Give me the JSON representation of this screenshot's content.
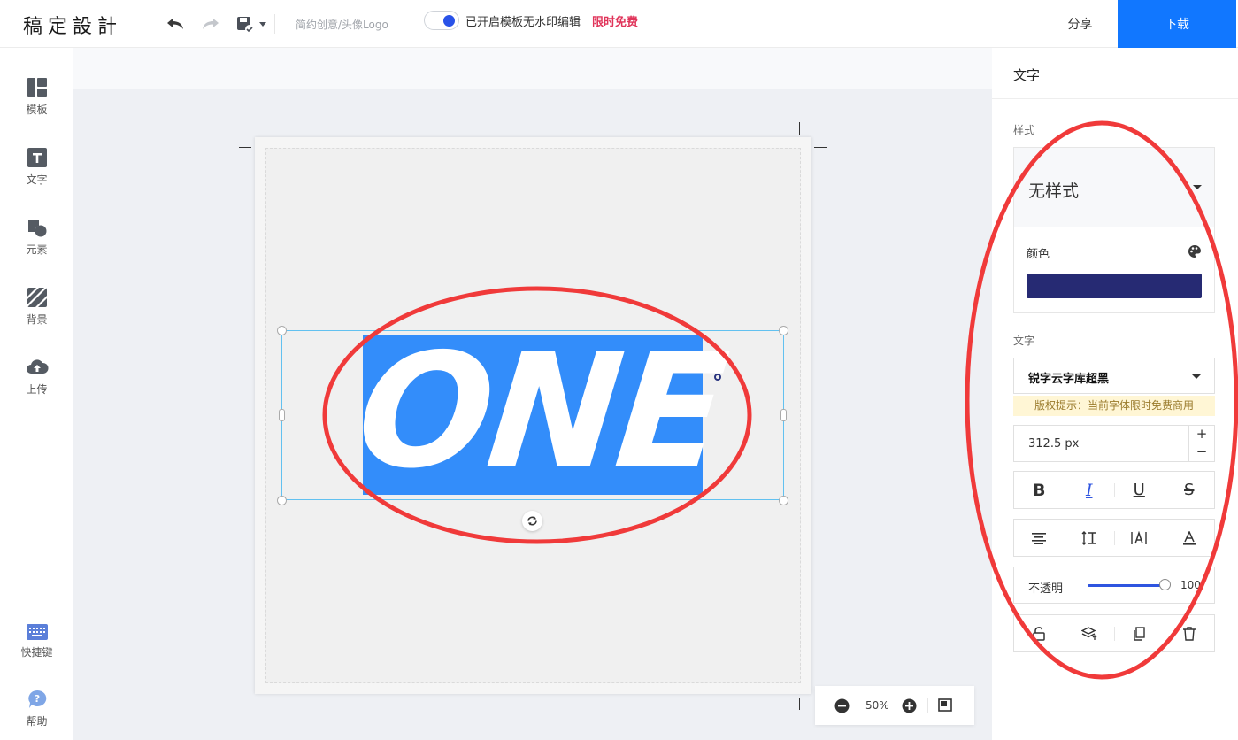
{
  "app": {
    "logo": "稿定設計"
  },
  "header": {
    "doc_title": "简约创意/头像Logo",
    "share_label": "分享",
    "download_label": "下载"
  },
  "leftbar": {
    "items": [
      {
        "label": "模板",
        "icon": "template-icon"
      },
      {
        "label": "文字",
        "icon": "text-icon"
      },
      {
        "label": "元素",
        "icon": "element-icon"
      },
      {
        "label": "背景",
        "icon": "background-icon"
      },
      {
        "label": "上传",
        "icon": "upload-icon"
      }
    ],
    "bottom": [
      {
        "label": "快捷键",
        "icon": "keyboard-icon"
      },
      {
        "label": "帮助",
        "icon": "help-icon"
      }
    ]
  },
  "watermark": {
    "text": "已开启模板无水印编辑",
    "free": "限时免费"
  },
  "canvas": {
    "text": "ONE",
    "zoom": "50%"
  },
  "rightpanel": {
    "title": "文字",
    "style_label": "样式",
    "style_value": "无样式",
    "color_label": "颜色",
    "color_value": "#262a73",
    "font_section_label": "文字",
    "font_name": "锐字云字库超黑",
    "copyright_notice": "版权提示：当前字体限时免费商用",
    "font_size": "312.5 px",
    "stepper_plus": "+",
    "stepper_minus": "−",
    "format_buttons": [
      "B",
      "I",
      "U",
      "S"
    ],
    "opacity_label": "不透明",
    "opacity_value": "100"
  },
  "colors": {
    "accent": "#1177ff",
    "selection_bg": "#338dfa",
    "annotation": "#f03a3a",
    "free_text": "#e0345a"
  }
}
